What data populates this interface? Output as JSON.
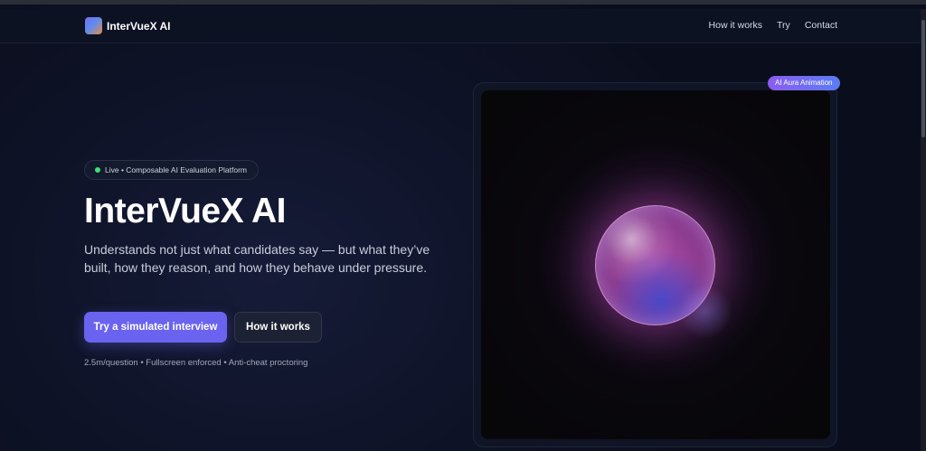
{
  "nav": {
    "brand": "InterVueX AI",
    "links": [
      "How it works",
      "Try",
      "Contact"
    ]
  },
  "hero": {
    "pill": "Live • Composable AI Evaluation Platform",
    "title": "InterVueX AI",
    "subtitle": "Understands not just what candidates say — but what they’ve built, how they reason, and how they behave under pressure.",
    "primary_cta": "Try a simulated interview",
    "secondary_cta": "How it works",
    "meta": "2.5m/question • Fullscreen enforced • Anti-cheat proctoring"
  },
  "visual": {
    "badge": "AI Aura Animation"
  },
  "colors": {
    "accent": "#6a63f0",
    "live_dot": "#3ee07a",
    "background": "#0b1020"
  }
}
